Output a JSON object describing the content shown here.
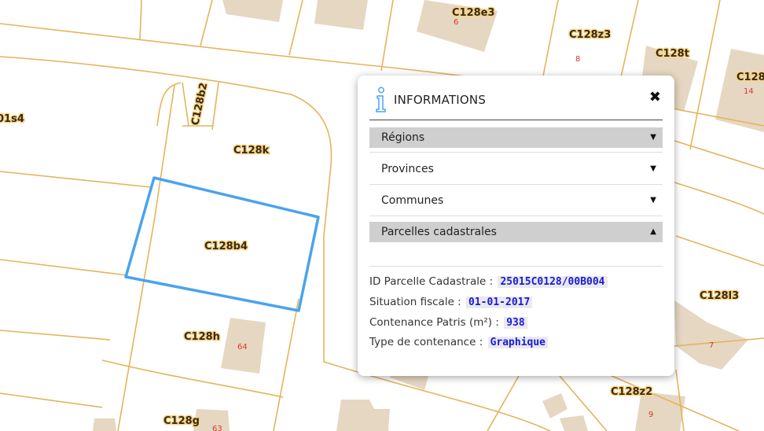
{
  "map": {
    "parcel_labels": [
      "C128e3",
      "C128z3",
      "C128t",
      "C128",
      "C128b2",
      "C128k",
      "C128b4",
      "C128h",
      "C128g",
      "C128l3",
      "C128z2",
      "01s4"
    ],
    "house_numbers": [
      "6",
      "8",
      "14",
      "64",
      "63",
      "7",
      "9"
    ],
    "selected_parcel": "C128b4",
    "colors": {
      "parcel_line": "#e4b45a",
      "building": "#e6d7c2",
      "selection": "#4aa3ee",
      "label_halo": "#f7d48a",
      "house_number": "#d63a2a"
    }
  },
  "panel": {
    "title": "INFORMATIONS",
    "close_icon": "close-icon",
    "sections": [
      {
        "label": "Régions",
        "expanded": false
      },
      {
        "label": "Provinces",
        "expanded": false
      },
      {
        "label": "Communes",
        "expanded": false
      },
      {
        "label": "Parcelles cadastrales",
        "expanded": true
      }
    ],
    "fields": [
      {
        "label": "ID Parcelle Cadastrale :",
        "value": "25015C0128/00B004"
      },
      {
        "label": "Situation fiscale :",
        "value": "01-01-2017"
      },
      {
        "label": "Contenance Patris (m²) :",
        "value": "938"
      },
      {
        "label": "Type de contenance :",
        "value": "Graphique"
      }
    ]
  }
}
